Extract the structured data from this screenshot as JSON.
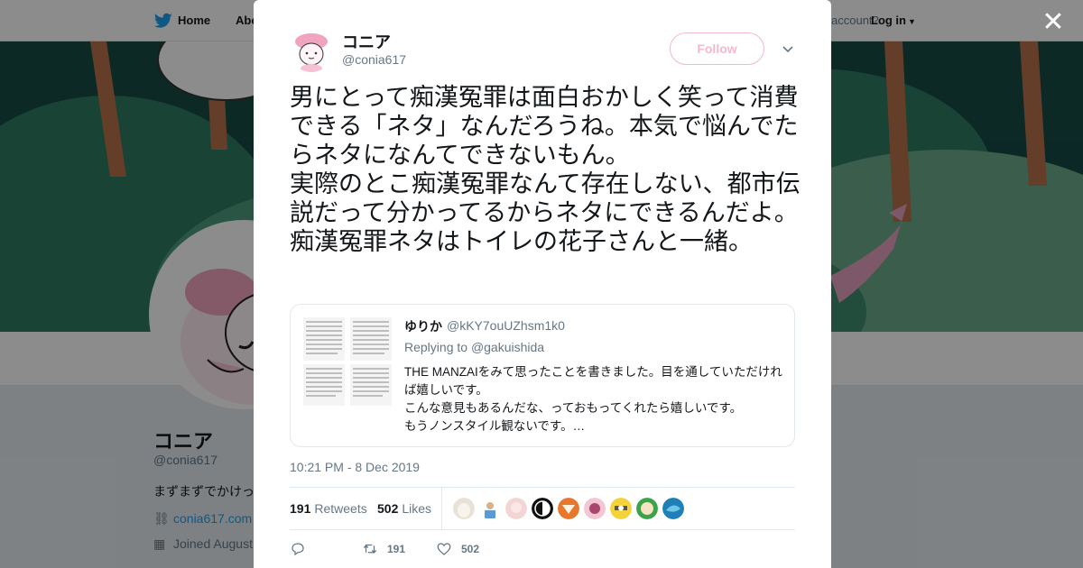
{
  "background": {
    "nav": {
      "home_label": "Home",
      "about_label": "Abo",
      "account_prompt": "account?",
      "login_label": "Log in"
    },
    "profile": {
      "name": "コニア",
      "handle": "@conia617",
      "bio": "まずまずでかけっ",
      "link": "conia617.com",
      "joined": "Joined August"
    }
  },
  "modal": {
    "close_icon": "close-icon",
    "author": {
      "name": "コニア",
      "handle": "@conia617"
    },
    "follow_label": "Follow",
    "tweet_text": "男にとって痴漢冤罪は面白おかしく笑って消費できる「ネタ」なんだろうね。本気で悩んでたらネタになんてできないもん。\n実際のとこ痴漢冤罪なんて存在しない、都市伝説だって分かってるからネタにできるんだよ。痴漢冤罪ネタはトイレの花子さんと一緒。",
    "quote": {
      "name": "ゆりか",
      "handle": "@kKY7ouUZhsm1k0",
      "replying_prefix": "Replying to",
      "replying_to": "@gakuishida",
      "body": "THE MANZAIをみて思ったことを書きました。目を通していただければ嬉しいです。\nこんな意見もあるんだな、っておもってくれたら嬉しいです。\nもうノンスタイル観ないです。…"
    },
    "timestamp": "10:21 PM - 8 Dec 2019",
    "stats": {
      "retweets_count": "191",
      "retweets_label": "Retweets",
      "likes_count": "502",
      "likes_label": "Likes"
    },
    "actions": {
      "retweet_count": "191",
      "like_count": "502"
    },
    "colors": {
      "follow_border": "#f5b8cb",
      "muted": "#657786",
      "link": "#1da1f2"
    }
  }
}
